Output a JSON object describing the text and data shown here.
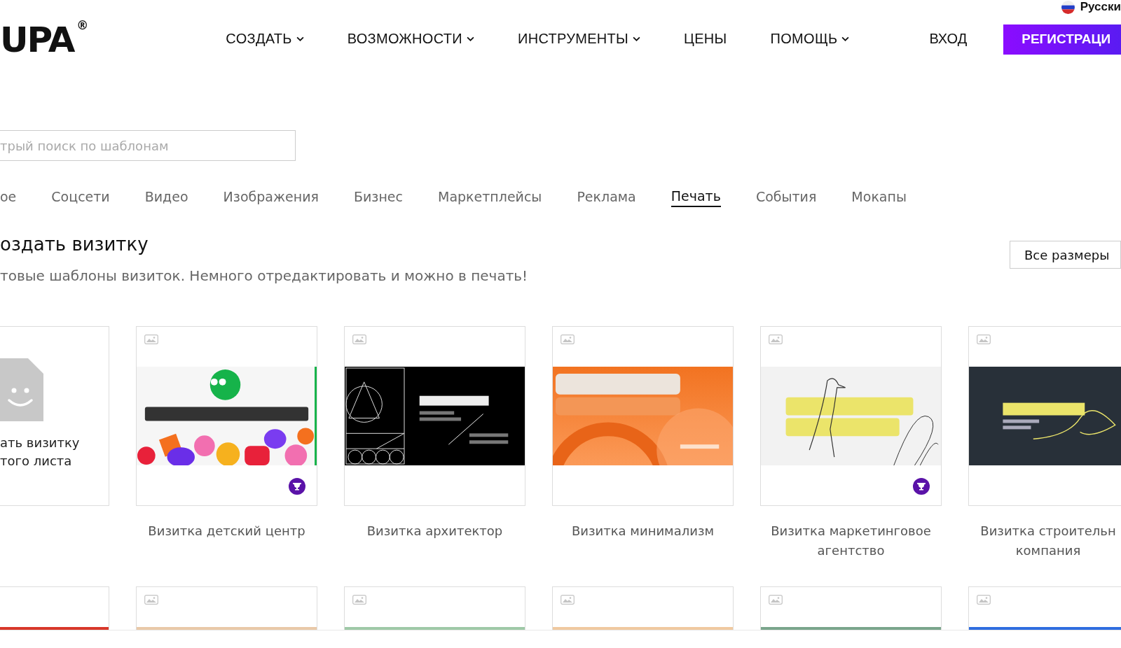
{
  "header": {
    "logo": "UPA",
    "logo_mark": "®",
    "nav": [
      {
        "label": "СОЗДАТЬ",
        "dropdown": true
      },
      {
        "label": "ВОЗМОЖНОСТИ",
        "dropdown": true
      },
      {
        "label": "ИНСТРУМЕНТЫ",
        "dropdown": true
      },
      {
        "label": "ЦЕНЫ",
        "dropdown": false
      },
      {
        "label": "ПОМОЩЬ",
        "dropdown": true
      }
    ],
    "login": "ВХОД",
    "register": "РЕГИСТРАЦИ",
    "language": "Русски"
  },
  "search": {
    "placeholder": "трый поиск по шаблонам"
  },
  "categories": [
    {
      "label": "ое",
      "selected": false
    },
    {
      "label": "Соцсети",
      "selected": false
    },
    {
      "label": "Видео",
      "selected": false
    },
    {
      "label": "Изображения",
      "selected": false
    },
    {
      "label": "Бизнес",
      "selected": false
    },
    {
      "label": "Маркетплейсы",
      "selected": false
    },
    {
      "label": "Реклама",
      "selected": false
    },
    {
      "label": "Печать",
      "selected": true
    },
    {
      "label": "События",
      "selected": false
    },
    {
      "label": "Мокапы",
      "selected": false
    }
  ],
  "section": {
    "title": "оздать визитку",
    "subtitle": "товые шаблоны визиток. Немного отредактировать и можно в печать!",
    "sizes_button": "Все размеры"
  },
  "blank_card": {
    "label": "ать визитку\nтого листа"
  },
  "templates": [
    {
      "caption": "Визитка детский центр",
      "kind": "kids",
      "award": true
    },
    {
      "caption": "Визитка архитектор",
      "kind": "architect",
      "award": false
    },
    {
      "caption": "Визитка минимализм",
      "kind": "orange",
      "award": false
    },
    {
      "caption": "Визитка маркетинговое агентство",
      "kind": "sketch",
      "award": true
    },
    {
      "caption": "Визитка строительн компания",
      "kind": "dark",
      "award": false
    }
  ]
}
